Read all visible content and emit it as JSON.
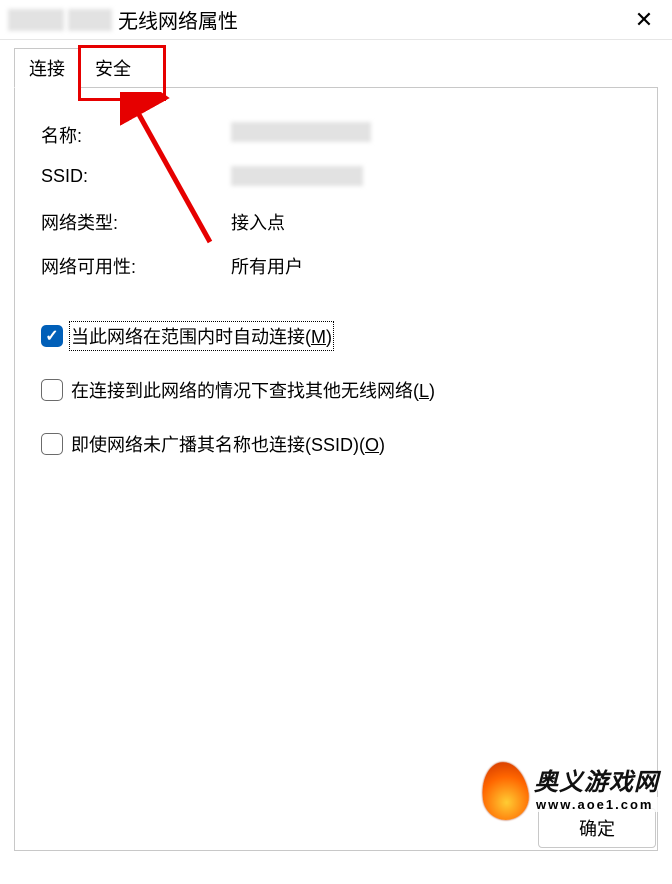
{
  "title": {
    "suffix": "无线网络属性"
  },
  "tabs": {
    "connection": "连接",
    "security": "安全"
  },
  "props": {
    "name_label": "名称:",
    "ssid_label": "SSID:",
    "nettype_label": "网络类型:",
    "nettype_value": "接入点",
    "avail_label": "网络可用性:",
    "avail_value": "所有用户"
  },
  "checks": {
    "auto_connect_pre": "当此网络在范围内时自动连接(",
    "auto_connect_mn": "M",
    "auto_connect_post": ")",
    "find_other_pre": "在连接到此网络的情况下查找其他无线网络(",
    "find_other_mn": "L",
    "find_other_post": ")",
    "hidden_ssid_pre": "即使网络未广播其名称也连接(SSID)(",
    "hidden_ssid_mn": "O",
    "hidden_ssid_post": ")"
  },
  "buttons": {
    "ok": "确定"
  },
  "watermark": {
    "cn": "奥义游戏网",
    "url": "www.aoe1.com"
  },
  "annotation": {
    "highlight_tab": "security",
    "arrow_color": "#e60000"
  }
}
